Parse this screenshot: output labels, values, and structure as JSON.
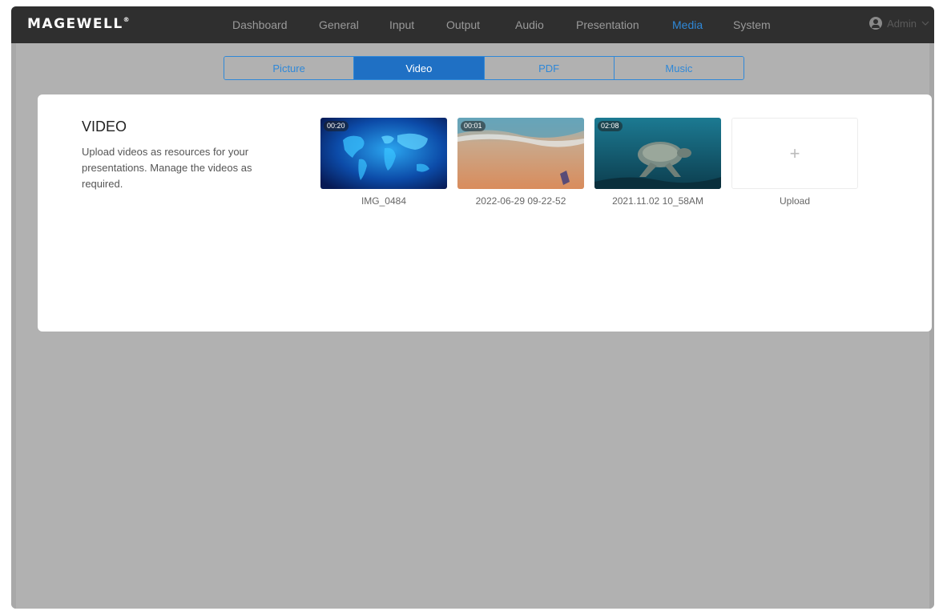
{
  "header": {
    "logo": "MAGEWELL",
    "nav": [
      {
        "label": "Dashboard",
        "active": false
      },
      {
        "label": "General",
        "active": false
      },
      {
        "label": "Input",
        "active": false
      },
      {
        "label": "Output",
        "active": false
      },
      {
        "label": "Audio",
        "active": false
      },
      {
        "label": "Presentation",
        "active": false
      },
      {
        "label": "Media",
        "active": true
      },
      {
        "label": "System",
        "active": false
      }
    ],
    "user": {
      "name": "Admin",
      "icon": "user-icon",
      "chevron": "chevron-down-icon"
    }
  },
  "tabs": [
    {
      "label": "Picture",
      "active": false
    },
    {
      "label": "Video",
      "active": true
    },
    {
      "label": "PDF",
      "active": false
    },
    {
      "label": "Music",
      "active": false
    }
  ],
  "section": {
    "title": "VIDEO",
    "description": "Upload videos as resources for your presentations. Manage the videos as required."
  },
  "videos": [
    {
      "name": "IMG_0484",
      "duration": "00:20",
      "thumbnail": "world-map"
    },
    {
      "name": "2022-06-29 09-22-52",
      "duration": "00:01",
      "thumbnail": "beach-sand"
    },
    {
      "name": "2021.11.02 10_58AM",
      "duration": "02:08",
      "thumbnail": "sea-turtle"
    }
  ],
  "upload": {
    "label": "Upload",
    "icon": "plus-icon",
    "symbol": "+"
  },
  "colors": {
    "accent": "#2f88d8",
    "active_tab": "#1f70c4",
    "topbar": "#2f2f2f",
    "backdrop": "#b1b1b1"
  }
}
